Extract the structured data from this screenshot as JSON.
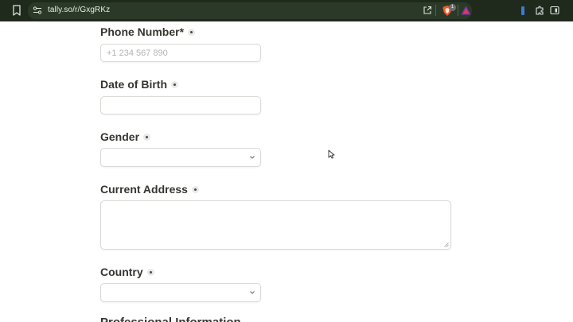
{
  "browser": {
    "url": "tally.so/r/GxgRKz",
    "brave_badge_count": "1"
  },
  "form": {
    "phone": {
      "label": "Phone Number*",
      "placeholder": "+1 234 567 890"
    },
    "dob": {
      "label": "Date of Birth"
    },
    "gender": {
      "label": "Gender"
    },
    "address": {
      "label": "Current Address"
    },
    "country": {
      "label": "Country"
    },
    "next_section_title": "Professional Information"
  },
  "colors": {
    "chrome_bg": "#1f2a1d",
    "label_text": "#37352f",
    "input_border": "#d9d9d6"
  }
}
